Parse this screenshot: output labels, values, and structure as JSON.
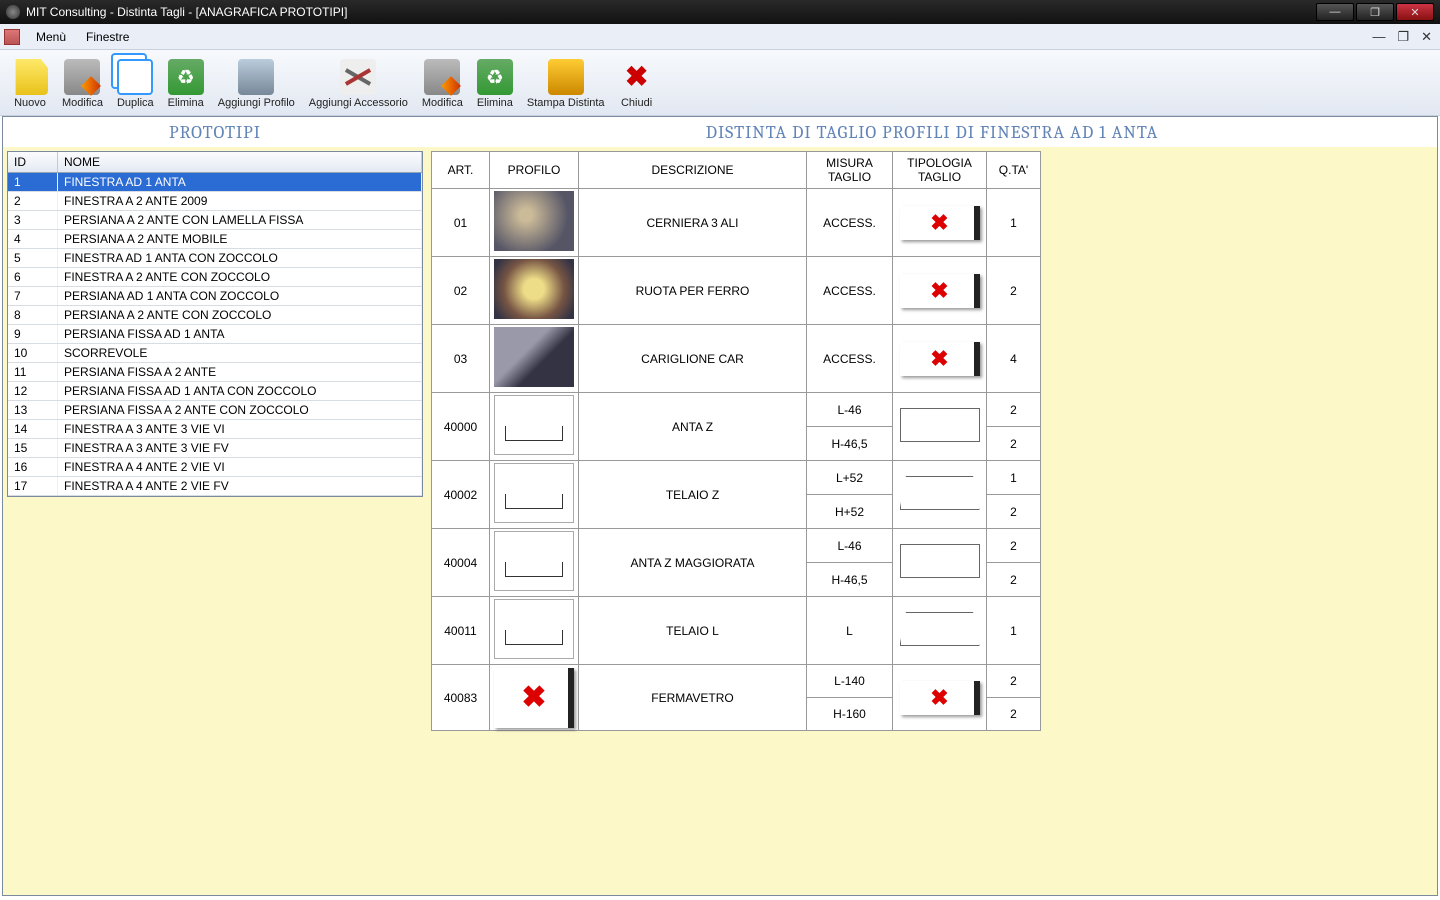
{
  "window": {
    "title": "MIT Consulting - Distinta Tagli - [ANAGRAFICA PROTOTIPI]"
  },
  "menu": {
    "items": [
      "Menù",
      "Finestre"
    ]
  },
  "toolbar": {
    "nuovo": "Nuovo",
    "modifica": "Modifica",
    "duplica": "Duplica",
    "elimina": "Elimina",
    "aggiungi_profilo": "Aggiungi Profilo",
    "aggiungi_accessorio": "Aggiungi Accessorio",
    "modifica2": "Modifica",
    "elimina2": "Elimina",
    "stampa": "Stampa Distinta",
    "chiudi": "Chiudi"
  },
  "left": {
    "title": "PROTOTIPI",
    "headers": {
      "id": "ID",
      "nome": "NOME"
    },
    "rows": [
      {
        "id": "1",
        "nome": "FINESTRA AD 1 ANTA",
        "selected": true
      },
      {
        "id": "2",
        "nome": "FINESTRA A 2 ANTE 2009"
      },
      {
        "id": "3",
        "nome": "PERSIANA A 2 ANTE CON LAMELLA FISSA"
      },
      {
        "id": "4",
        "nome": "PERSIANA A 2 ANTE MOBILE"
      },
      {
        "id": "5",
        "nome": "FINESTRA AD 1 ANTA CON ZOCCOLO"
      },
      {
        "id": "6",
        "nome": "FINESTRA A 2 ANTE CON ZOCCOLO"
      },
      {
        "id": "7",
        "nome": "PERSIANA AD 1 ANTA CON ZOCCOLO"
      },
      {
        "id": "8",
        "nome": "PERSIANA A 2 ANTE CON ZOCCOLO"
      },
      {
        "id": "9",
        "nome": "PERSIANA FISSA AD 1 ANTA"
      },
      {
        "id": "10",
        "nome": "SCORREVOLE"
      },
      {
        "id": "11",
        "nome": "PERSIANA FISSA A 2 ANTE"
      },
      {
        "id": "12",
        "nome": "PERSIANA FISSA AD 1 ANTA CON ZOCCOLO"
      },
      {
        "id": "13",
        "nome": "PERSIANA FISSA A 2 ANTE CON ZOCCOLO"
      },
      {
        "id": "14",
        "nome": "FINESTRA A 3 ANTE 3 VIE VI"
      },
      {
        "id": "15",
        "nome": "FINESTRA A 3 ANTE 3 VIE FV"
      },
      {
        "id": "16",
        "nome": "FINESTRA A 4 ANTE 2 VIE VI"
      },
      {
        "id": "17",
        "nome": "FINESTRA A 4 ANTE 2 VIE FV"
      }
    ]
  },
  "right": {
    "title": "DISTINTA DI TAGLIO PROFILI DI FINESTRA AD 1 ANTA",
    "headers": {
      "art": "ART.",
      "profilo": "PROFILO",
      "descrizione": "DESCRIZIONE",
      "misura": "MISURA TAGLIO",
      "tipologia": "TIPOLOGIA TAGLIO",
      "qta": "Q.TA'"
    },
    "rows": [
      {
        "art": "01",
        "profilo_kind": "accessory1",
        "desc": "CERNIERA 3 ALI",
        "misura": [
          "ACCESS."
        ],
        "tip": "redx",
        "qta": [
          "1"
        ]
      },
      {
        "art": "02",
        "profilo_kind": "accessory2",
        "desc": "RUOTA PER FERRO",
        "misura": [
          "ACCESS."
        ],
        "tip": "redx",
        "qta": [
          "2"
        ]
      },
      {
        "art": "03",
        "profilo_kind": "accessory3",
        "desc": "CARIGLIONE CAR",
        "misura": [
          "ACCESS."
        ],
        "tip": "redx",
        "qta": [
          "4"
        ]
      },
      {
        "art": "40000",
        "profilo_kind": "profile",
        "desc": "ANTA Z",
        "misura": [
          "L-46",
          "H-46,5"
        ],
        "tip": "rect",
        "qta": [
          "2",
          "2"
        ]
      },
      {
        "art": "40002",
        "profilo_kind": "profile",
        "desc": "TELAIO Z",
        "misura": [
          "L+52",
          "H+52"
        ],
        "tip": "trap",
        "qta": [
          "1",
          "2"
        ]
      },
      {
        "art": "40004",
        "profilo_kind": "profile",
        "desc": "ANTA Z MAGGIORATA",
        "misura": [
          "L-46",
          "H-46,5"
        ],
        "tip": "rect",
        "qta": [
          "2",
          "2"
        ]
      },
      {
        "art": "40011",
        "profilo_kind": "profile",
        "desc": "TELAIO L",
        "misura": [
          "L"
        ],
        "tip": "trap",
        "qta": [
          "1"
        ]
      },
      {
        "art": "40083",
        "profilo_kind": "redx",
        "desc": "FERMAVETRO",
        "misura": [
          "L-140",
          "H-160"
        ],
        "tip": "redx",
        "qta": [
          "2",
          "2"
        ]
      }
    ]
  }
}
